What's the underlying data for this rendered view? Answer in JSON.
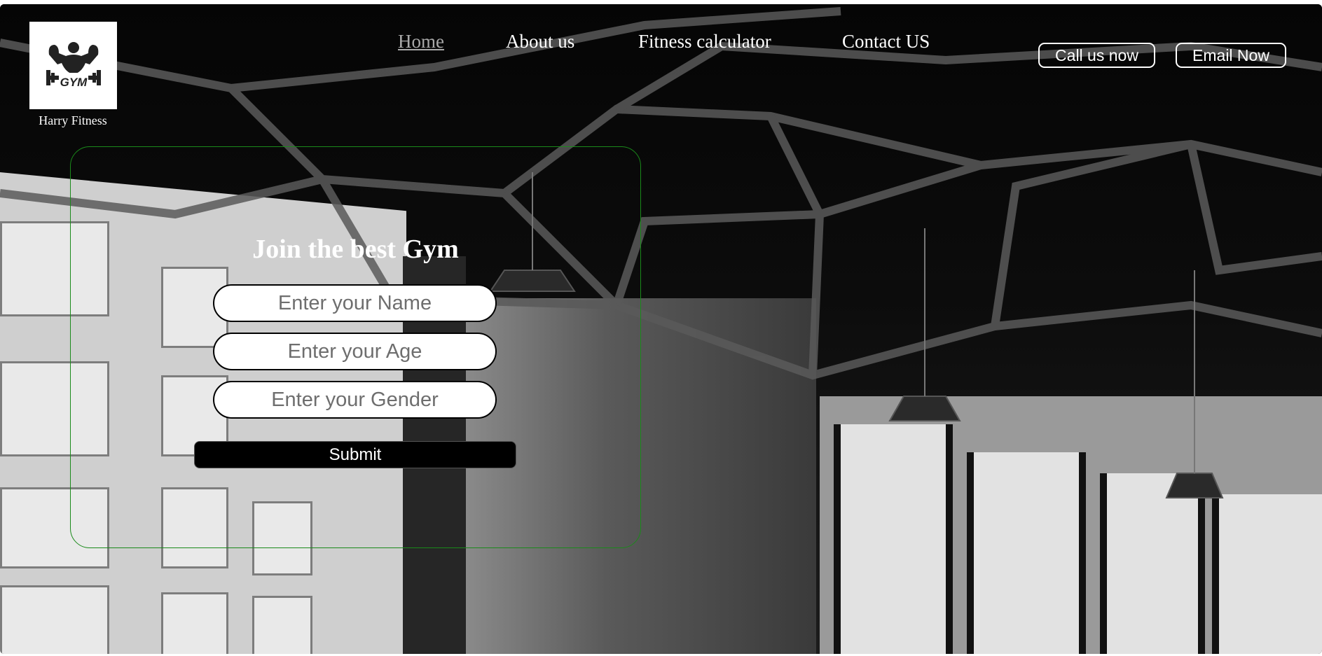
{
  "brand": {
    "logo_icon": "gym-bodybuilder-icon",
    "logo_text": "GYM",
    "name": "Harry Fitness"
  },
  "nav": {
    "items": [
      {
        "label": "Home",
        "active": true
      },
      {
        "label": "About us",
        "active": false
      },
      {
        "label": "Fitness calculator",
        "active": false
      },
      {
        "label": "Contact US",
        "active": false
      }
    ]
  },
  "header_buttons": {
    "call": "Call us now",
    "email": "Email Now"
  },
  "form": {
    "title": "Join the best Gym",
    "name_placeholder": "Enter your Name",
    "age_placeholder": "Enter your Age",
    "gender_placeholder": "Enter your Gender",
    "submit_label": "Submit"
  },
  "colors": {
    "card_border": "#1a8a1a",
    "nav_active": "#a9a9a9",
    "text": "#ffffff"
  }
}
